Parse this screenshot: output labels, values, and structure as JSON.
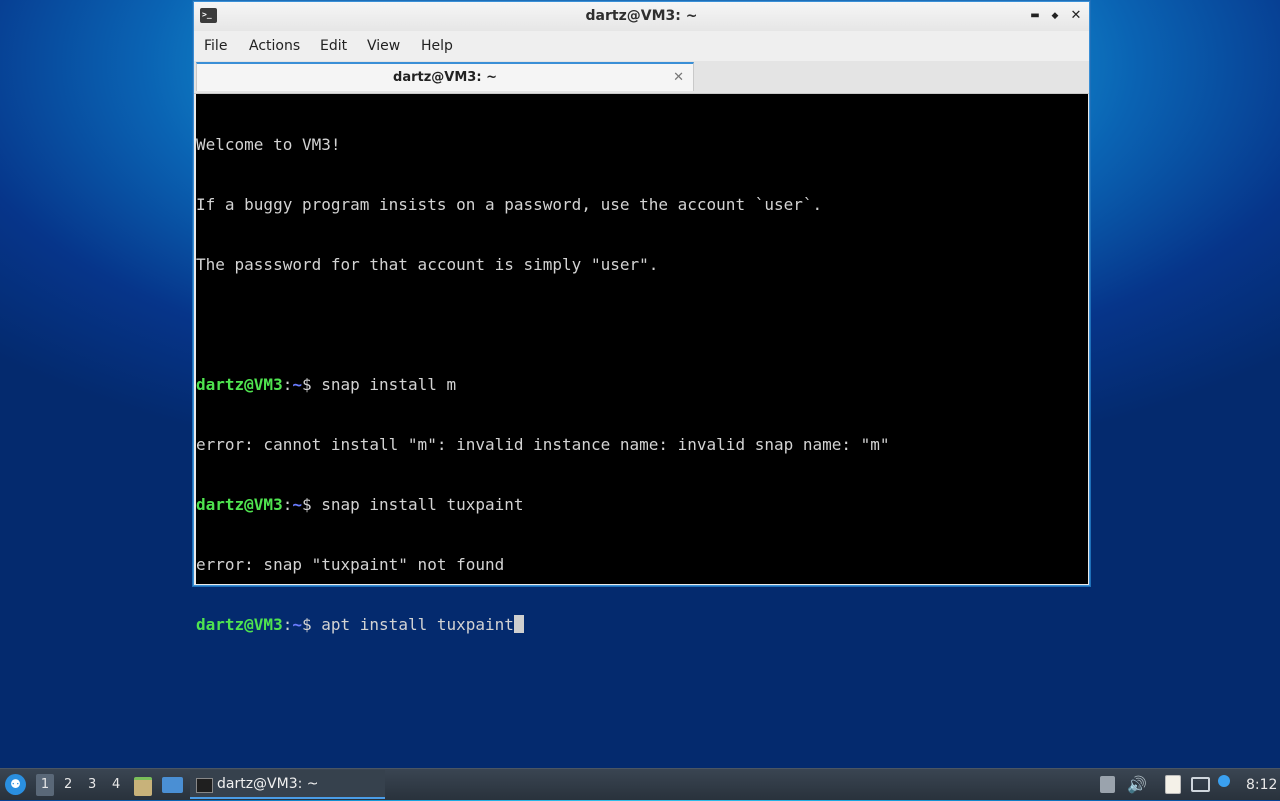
{
  "window": {
    "title": "dartz@VM3: ~",
    "menu": [
      "File",
      "Actions",
      "Edit",
      "View",
      "Help"
    ],
    "tab_label": "dartz@VM3: ~",
    "tab_close": "✕",
    "btn_minimize": "▬",
    "btn_maximize": "◆",
    "btn_close": "✕"
  },
  "terminal": {
    "welcome": "Welcome to VM3!",
    "notice1": "If a buggy program insists on a password, use the account `user`.",
    "notice2": "The passsword for that account is simply \"user\".",
    "prompt_user": "dartz@VM3",
    "prompt_sep": ":",
    "prompt_path": "~",
    "prompt_end": "$ ",
    "cmd1": "snap install m",
    "out1": "error: cannot install \"m\": invalid instance name: invalid snap name: \"m\"",
    "cmd2": "snap install tuxpaint",
    "out2": "error: snap \"tuxpaint\" not found",
    "cmd3": "apt install tuxpaint"
  },
  "taskbar": {
    "workspaces": [
      "1",
      "2",
      "3",
      "4"
    ],
    "task_label": "dartz@VM3: ~",
    "clock": "8:12",
    "tray_icons": [
      "eject-icon",
      "volume-icon",
      "clipboard-icon",
      "network-icon",
      "notification-icon"
    ]
  }
}
